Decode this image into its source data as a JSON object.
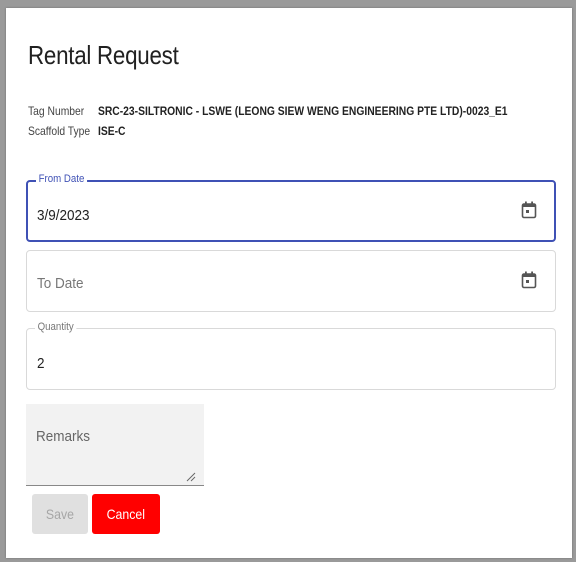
{
  "dialog": {
    "title": "Rental Request",
    "tag_number": {
      "label": "Tag Number",
      "value": "SRC-23-SILTRONIC - LSWE (LEONG SIEW WENG ENGINEERING PTE LTD)-0023_E1"
    },
    "scaffold_type": {
      "label": "Scaffold Type",
      "value": "ISE-C"
    }
  },
  "form": {
    "from_date": {
      "label": "From Date",
      "value": "3/9/2023",
      "icon": "calendar-icon"
    },
    "to_date": {
      "placeholder": "To Date",
      "icon": "calendar-icon"
    },
    "quantity": {
      "label": "Quantity",
      "value": "2"
    },
    "remarks": {
      "placeholder": "Remarks"
    }
  },
  "buttons": {
    "save": "Save",
    "cancel": "Cancel"
  },
  "colors": {
    "accent": "#3f51b5",
    "cancel": "#ff0000",
    "disabled": "#e0e0e0"
  }
}
